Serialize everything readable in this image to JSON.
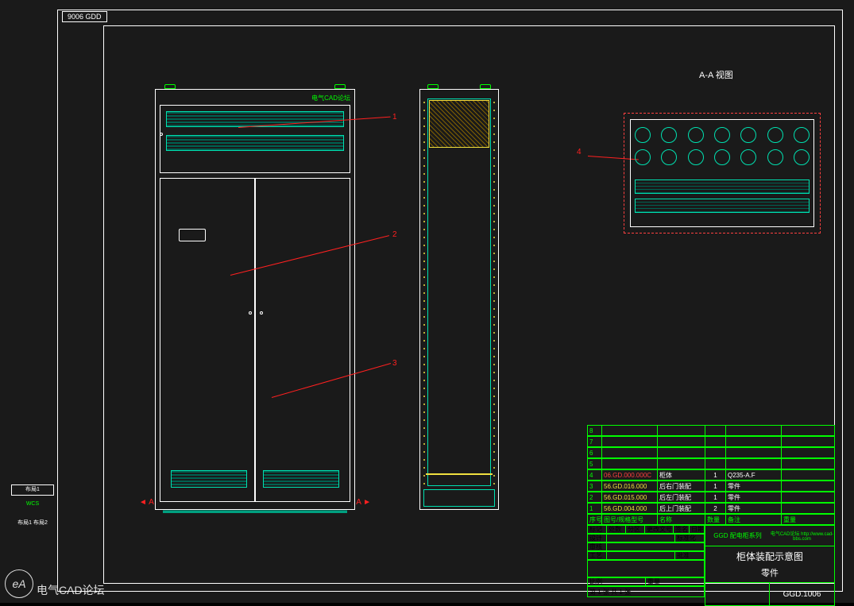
{
  "meta": {
    "tab_label": "9006 GDD",
    "top_view_heading": "A-A 视图",
    "section_mark_left": "A",
    "section_mark_right": "A",
    "cad_text": "电气CAD论坛"
  },
  "leaders": {
    "one": "1",
    "two": "2",
    "three": "3",
    "four": "4"
  },
  "side_strip": {
    "label1": "布局1",
    "label2": "WCS",
    "label3": "布局1 布局2"
  },
  "bom": {
    "header": {
      "c1": "序号",
      "c2": "图号/规格型号",
      "c3": "名称",
      "c4": "数量",
      "c5": "备注",
      "c6": "重量"
    },
    "rows": [
      {
        "n": "8",
        "code": "",
        "name": "",
        "qty": "",
        "note": ""
      },
      {
        "n": "7",
        "code": "",
        "name": "",
        "qty": "",
        "note": ""
      },
      {
        "n": "6",
        "code": "",
        "name": "",
        "qty": "",
        "note": ""
      },
      {
        "n": "5",
        "code": "",
        "name": "",
        "qty": "",
        "note": ""
      },
      {
        "n": "4",
        "code": "06.GD.000.000C",
        "name": "柜体",
        "qty": "1",
        "note": "Q235-A.F",
        "red": true
      },
      {
        "n": "3",
        "code": "56.GD.016.000",
        "name": "后右门装配",
        "qty": "1",
        "note": "零件",
        "yellow": true
      },
      {
        "n": "2",
        "code": "56.GD.015.000",
        "name": "后左门装配",
        "qty": "1",
        "note": "零件",
        "yellow": true
      },
      {
        "n": "1",
        "code": "56.GD.004.000",
        "name": "后上门装配",
        "qty": "2",
        "note": "零件",
        "yellow": true
      }
    ]
  },
  "title_block": {
    "company_row": "GGD 配电柜系列",
    "url": "电气CAD论坛  http://www.cad-bbs.com",
    "drawing_title": "柜体装配示意图",
    "subtype": "零件",
    "drawing_no": "GGD.1006",
    "left_fields": {
      "r1a": "标记",
      "r1b": "处数",
      "r1c": "分区",
      "r1d": "更改文号",
      "r1e": "签名",
      "r1f": "日期",
      "r2a": "设计",
      "r2b": "",
      "r2c": "标准化",
      "r3a": "审核",
      "r3b": "",
      "r4a": "工艺",
      "r4b": "批准",
      "scale": "比例",
      "sheet": "第 1 张  共 1 张",
      "weight": "重量"
    }
  },
  "watermark": {
    "logo": "eA",
    "text": "电气CAD论坛"
  }
}
